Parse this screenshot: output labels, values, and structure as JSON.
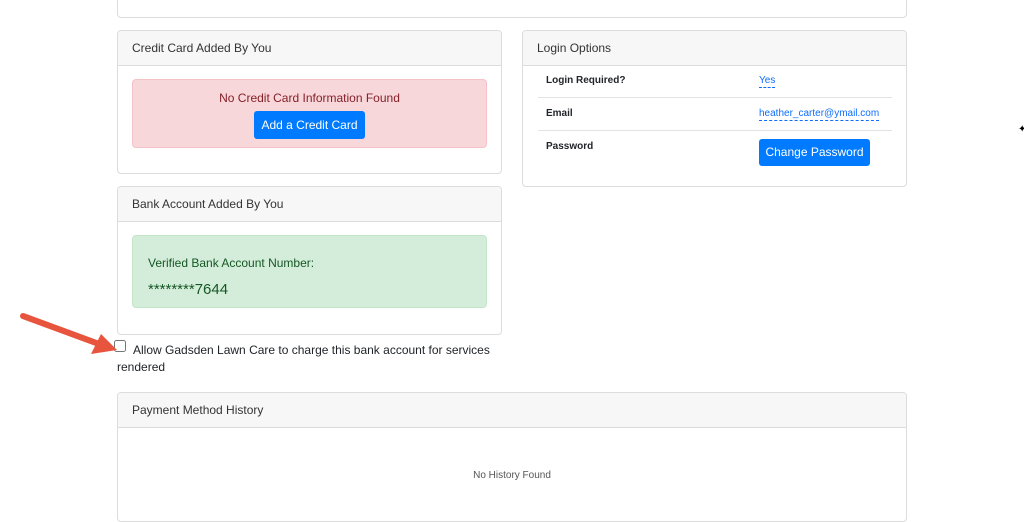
{
  "credit_card": {
    "header": "Credit Card Added By You",
    "empty_message": "No Credit Card Information Found",
    "add_button": "Add a Credit Card"
  },
  "bank_account": {
    "header": "Bank Account Added By You",
    "verified_label": "Verified Bank Account Number:",
    "account_number": "********7644"
  },
  "authorize": {
    "checked": false,
    "label": "Allow Gadsden Lawn Care to charge this bank account for services rendered"
  },
  "login_options": {
    "header": "Login Options",
    "rows": [
      {
        "label": "Login Required?",
        "value": "Yes"
      },
      {
        "label": "Email",
        "value": "heather_carter@ymail.com"
      },
      {
        "label": "Password",
        "button": "Change Password"
      }
    ]
  },
  "payment_history": {
    "header": "Payment Method History",
    "empty_message": "No History Found"
  },
  "colors": {
    "primary": "#007bff",
    "danger_bg": "#f8d7da",
    "success_bg": "#d4edda",
    "arrow": "#e8553e"
  }
}
